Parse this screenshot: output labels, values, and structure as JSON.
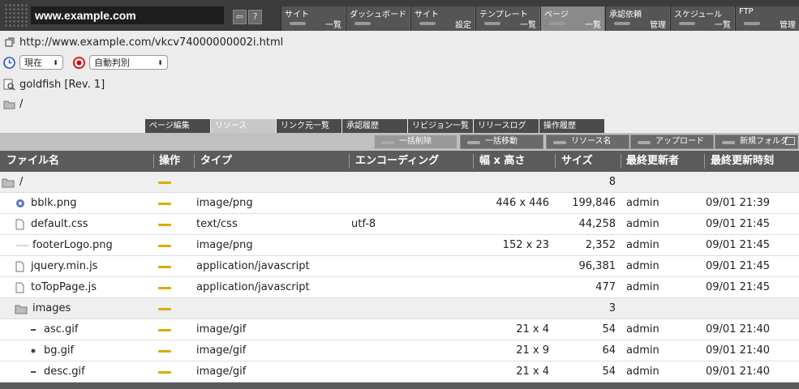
{
  "header": {
    "site": "www.example.com",
    "help_label": "?",
    "nav": [
      {
        "top": "サイト",
        "bottom": "一覧",
        "active": false
      },
      {
        "top": "ダッシュボード",
        "bottom": "",
        "active": false
      },
      {
        "top": "サイト",
        "bottom": "設定",
        "active": false
      },
      {
        "top": "テンプレート",
        "bottom": "一覧",
        "active": false
      },
      {
        "top": "ページ",
        "bottom": "一覧",
        "active": true
      },
      {
        "top": "承認依頼",
        "bottom": "管理",
        "active": false
      },
      {
        "top": "スケジュール",
        "bottom": "一覧",
        "active": false
      },
      {
        "top": "FTP",
        "bottom": "管理",
        "active": false
      }
    ]
  },
  "info": {
    "url": "http://www.example.com/vkcv74000000002i.html",
    "time_select": "現在",
    "mode_select": "自動判別",
    "page_name": "goldfish [Rev. 1]",
    "path": "/"
  },
  "tabs": [
    "ページ編集",
    "リソース",
    "リンク元一覧",
    "承認履歴",
    "リビジョン一覧",
    "リリースログ",
    "操作履歴"
  ],
  "actions": [
    "一括削除",
    "一括移動",
    "リソース名",
    "アップロード",
    "新規フォルダ"
  ],
  "columns": [
    "ファイル名",
    "操作",
    "タイプ",
    "エンコーディング",
    "幅 x 高さ",
    "サイズ",
    "最終更新者",
    "最終更新時刻"
  ],
  "rows": [
    {
      "name": "/",
      "type": "",
      "enc": "",
      "dim": "",
      "size": "8",
      "user": "",
      "time": "",
      "kind": "folder",
      "indent": 0
    },
    {
      "name": "bblk.png",
      "type": "image/png",
      "enc": "",
      "dim": "446 x 446",
      "size": "199,846",
      "user": "admin",
      "time": "09/01 21:39",
      "kind": "image",
      "indent": 1
    },
    {
      "name": "default.css",
      "type": "text/css",
      "enc": "utf-8",
      "dim": "",
      "size": "44,258",
      "user": "admin",
      "time": "09/01 21:45",
      "kind": "doc",
      "indent": 1
    },
    {
      "name": "footerLogo.png",
      "type": "image/png",
      "enc": "",
      "dim": "152 x 23",
      "size": "2,352",
      "user": "admin",
      "time": "09/01 21:45",
      "kind": "line",
      "indent": 1
    },
    {
      "name": "jquery.min.js",
      "type": "application/javascript",
      "enc": "",
      "dim": "",
      "size": "96,381",
      "user": "admin",
      "time": "09/01 21:45",
      "kind": "doc",
      "indent": 1
    },
    {
      "name": "toTopPage.js",
      "type": "application/javascript",
      "enc": "",
      "dim": "",
      "size": "477",
      "user": "admin",
      "time": "09/01 21:45",
      "kind": "doc",
      "indent": 1
    },
    {
      "name": "images",
      "type": "",
      "enc": "",
      "dim": "",
      "size": "3",
      "user": "",
      "time": "",
      "kind": "folder",
      "indent": 1
    },
    {
      "name": "asc.gif",
      "type": "image/gif",
      "enc": "",
      "dim": "21 x 4",
      "size": "54",
      "user": "admin",
      "time": "09/01 21:40",
      "kind": "dash",
      "indent": 2
    },
    {
      "name": "bg.gif",
      "type": "image/gif",
      "enc": "",
      "dim": "21 x 9",
      "size": "64",
      "user": "admin",
      "time": "09/01 21:40",
      "kind": "dot",
      "indent": 2
    },
    {
      "name": "desc.gif",
      "type": "image/gif",
      "enc": "",
      "dim": "21 x 4",
      "size": "54",
      "user": "admin",
      "time": "09/01 21:40",
      "kind": "dash",
      "indent": 2
    }
  ],
  "colors": {
    "header_bg": "#3c3c3c",
    "table_head": "#5b5b5b",
    "op_bar": "#e0a800",
    "record_icon": "#d40000",
    "clock_icon": "#1c4fd6"
  }
}
